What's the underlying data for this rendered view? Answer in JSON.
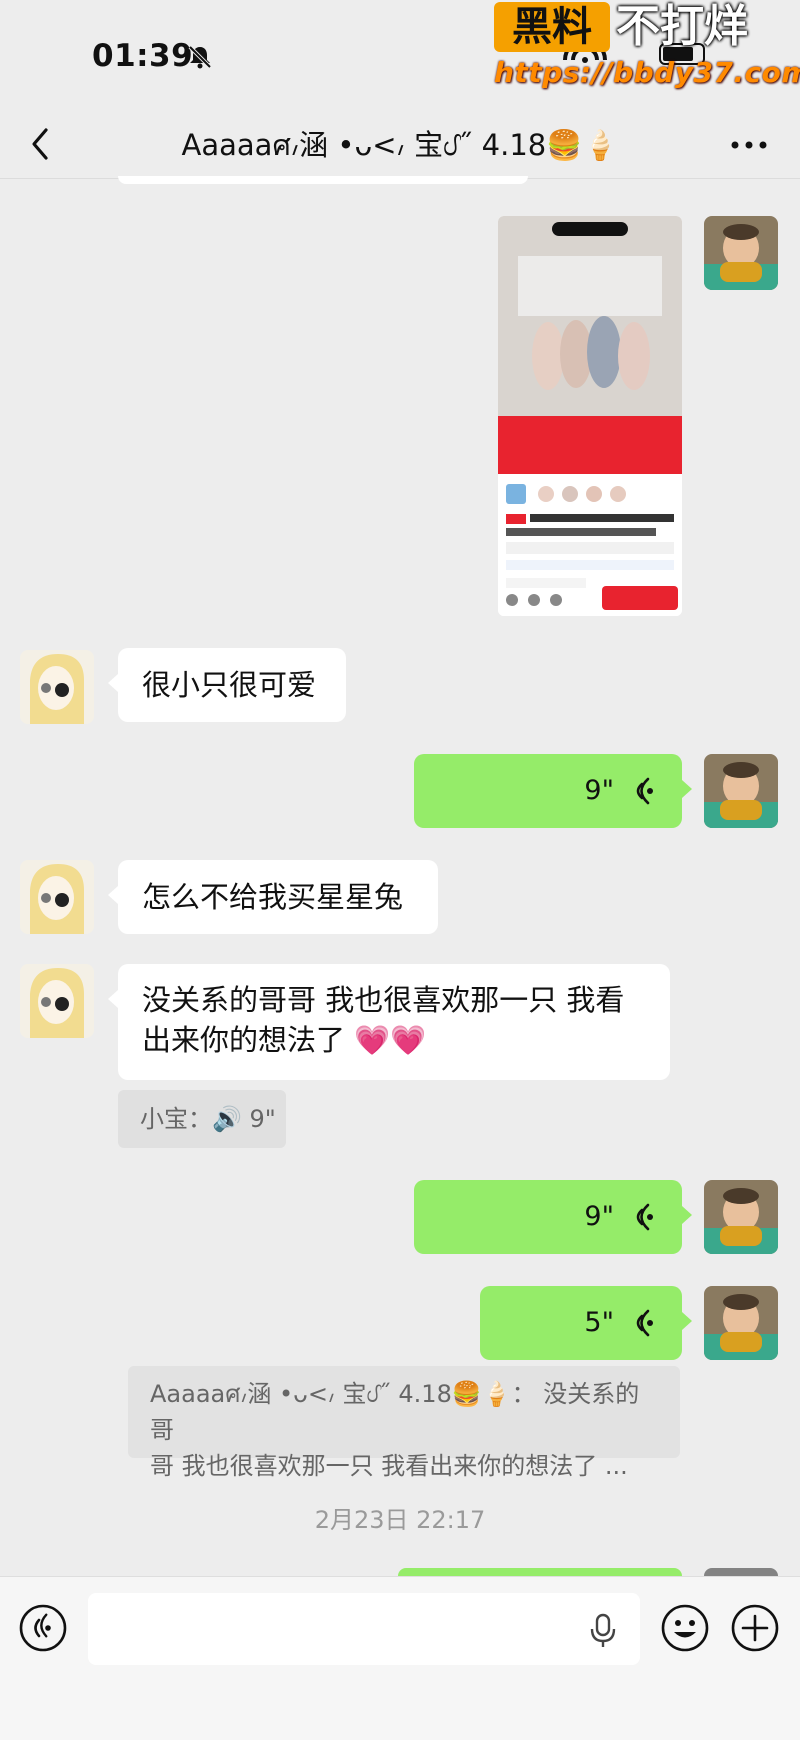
{
  "status_bar": {
    "time": "01:39"
  },
  "watermark": {
    "brand": "黑料",
    "slogan": "不打烊",
    "url": "https://bbdy37.com"
  },
  "nav": {
    "title": "Aaaaaศ៸涵 •ᴗ<៸ 宝ᦔ˝ 4.18🍔🍦"
  },
  "messages": {
    "m1_text": "很小只很可爱",
    "voice1_duration": "9\"",
    "m2_text": "怎么不给我买星星兔",
    "m3_line1": "没关系的哥哥 我也很喜欢那一只 我看",
    "m3_line2": "出来你的想法了 💗💗",
    "transcription": "小宝：🔊 9\"",
    "voice2_duration": "9\"",
    "voice3_duration": "5\"",
    "quote_line1": "Aaaaaศ៸涵 •ᴗ<៸ 宝ᦔ˝ 4.18🍔🍦： 没关系的哥",
    "quote_line2": "哥 我也很喜欢那一只 我看出来你的想法了 ..."
  },
  "timestamp": "2月23日 22:17",
  "colors": {
    "self_bubble": "#95ec69",
    "other_bubble": "#ffffff",
    "background": "#ededed",
    "product_red": "#e8232f"
  },
  "icons": [
    "bell-muted-icon",
    "back-icon",
    "more-icon",
    "voice-wave-icon",
    "keyboard-voice-icon",
    "mic-icon",
    "emoji-icon",
    "plus-icon"
  ]
}
